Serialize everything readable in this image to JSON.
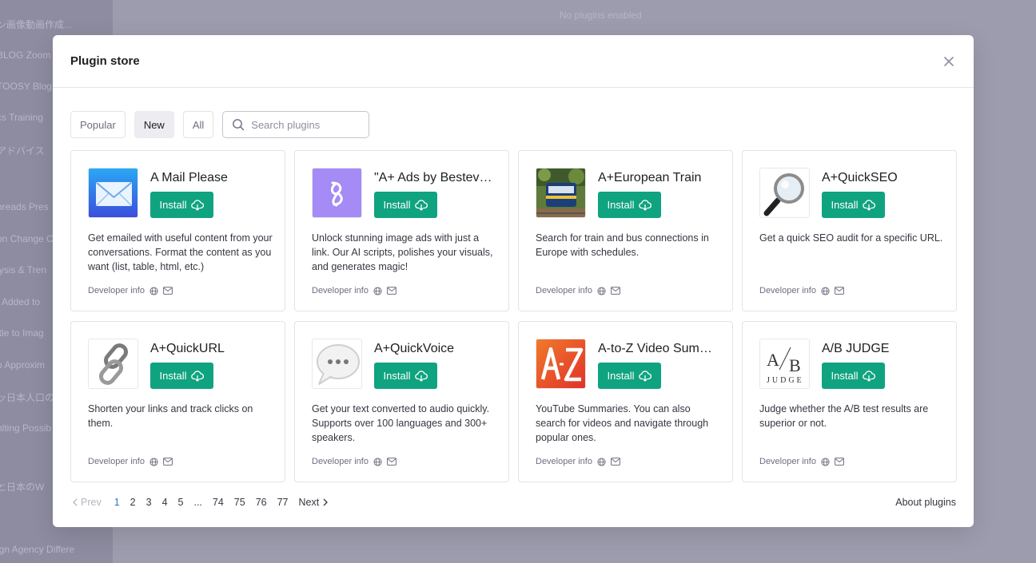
{
  "background": {
    "sidebar_items": [
      "ン画像動画作成...",
      "BLOG Zoom",
      "TOOSY Blog",
      "cs Training",
      "アドバイス",
      "hreads Pres",
      "on Change C",
      "lysis & Tren",
      "t Added to",
      "itle to Imag",
      "p Approxim",
      "ッ日本人口の",
      "hlting Possib",
      "と日本のW",
      "ign Agency Differe"
    ],
    "top_text": "No plugins enabled"
  },
  "modal": {
    "title": "Plugin store",
    "filters": [
      "Popular",
      "New",
      "All"
    ],
    "active_filter": "New",
    "search_placeholder": "Search plugins"
  },
  "install_label": "Install",
  "developer_info_label": "Developer info",
  "plugins": [
    {
      "name": "A Mail Please",
      "desc": "Get emailed with useful content from your conversations. Format the content as you want (list, table, html, etc.)",
      "logo": "mail-envelope-icon"
    },
    {
      "name": "\"A+ Ads by Bestever\"",
      "desc": "Unlock stunning image ads with just a link. Our AI scripts, polishes your visuals, and generates magic!",
      "logo": "bestever-b-icon"
    },
    {
      "name": "A+European Train",
      "desc": "Search for train and bus connections in Europe with schedules.",
      "logo": "train-photo"
    },
    {
      "name": "A+QuickSEO",
      "desc": "Get a quick SEO audit for a specific URL.",
      "logo": "magnifier-icon"
    },
    {
      "name": "A+QuickURL",
      "desc": "Shorten your links and track clicks on them.",
      "logo": "chain-link-icon"
    },
    {
      "name": "A+QuickVoice",
      "desc": "Get your text converted to audio quickly. Supports over 100 languages and 300+ speakers.",
      "logo": "speech-bubble-icon"
    },
    {
      "name": "A-to-Z Video Summary",
      "desc": "YouTube Summaries. You can also search for videos and navigate through popular ones.",
      "logo": "a-z-icon"
    },
    {
      "name": "A/B JUDGE",
      "desc": "Judge whether the A/B test results are superior or not.",
      "logo": "ab-judge-icon"
    }
  ],
  "pager": {
    "prev": "Prev",
    "pages": [
      "1",
      "2",
      "3",
      "4",
      "5",
      "...",
      "74",
      "75",
      "76",
      "77"
    ],
    "current": "1",
    "next": "Next"
  },
  "about": "About plugins",
  "colors": {
    "install": "#10a37f",
    "current_page": "#2f6fdb"
  }
}
